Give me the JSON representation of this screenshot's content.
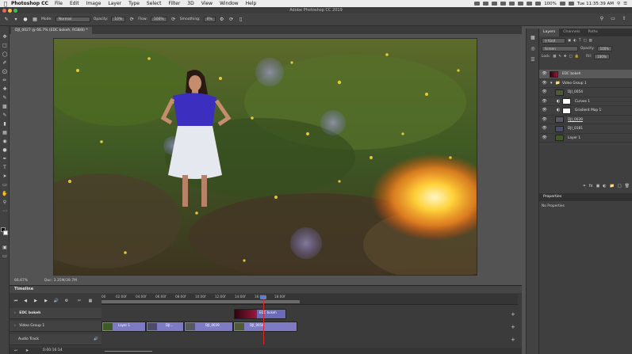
{
  "menubar": {
    "app": "Photoshop CC",
    "items": [
      "File",
      "Edit",
      "Image",
      "Layer",
      "Type",
      "Select",
      "Filter",
      "3D",
      "View",
      "Window",
      "Help"
    ],
    "battery": "100%",
    "clock": "Tue 11:35:39 AM"
  },
  "window": {
    "title": "Adobe Photoshop CC 2019"
  },
  "options": {
    "mode_label": "Mode:",
    "mode_value": "Normal",
    "opacity_label": "Opacity:",
    "opacity_value": "10%",
    "flow_label": "Flow:",
    "flow_value": "100%",
    "smoothing_label": "Smoothing:",
    "smoothing_value": "0%"
  },
  "document": {
    "tab": "DJI_0027 @ 66.7% (EDC bokeh, RGB/8) *"
  },
  "status": {
    "zoom": "66.67%",
    "doc": "Doc: 3.35M/39.7M"
  },
  "timeline": {
    "title": "Timeline",
    "ruler": [
      "00",
      "02:00f",
      "04:00f",
      "06:00f",
      "08:00f",
      "10:00f",
      "12:00f",
      "14:00f",
      "16:00f",
      "18:00f"
    ],
    "tracks": [
      {
        "label": "EDC bokeh"
      },
      {
        "label": "Video Group 1"
      },
      {
        "label": "Audio Track"
      }
    ],
    "clips": {
      "edc": "EDC bokeh",
      "layer1": "Layer 1",
      "dji1": "DJI...",
      "dji0039": "DJI_0039",
      "dji0054": "DJI_0054"
    },
    "time_display": "0:00:16:14"
  },
  "layers_panel": {
    "tabs": [
      "Layers",
      "Channels",
      "Paths"
    ],
    "filter": "Kind",
    "blend": "Screen",
    "opacity_label": "Opacity:",
    "opacity_value": "100%",
    "lock_label": "Lock:",
    "fill_label": "Fill:",
    "fill_value": "100%",
    "layers": [
      {
        "name": "EDC bokeh"
      },
      {
        "name": "Video Group 1"
      },
      {
        "name": "DJI_0054"
      },
      {
        "name": "Curves 1"
      },
      {
        "name": "Gradient Map 1"
      },
      {
        "name": "DJI_0039"
      },
      {
        "name": "DJI_0181"
      },
      {
        "name": "Layer 1"
      }
    ]
  },
  "properties_panel": {
    "title": "Properties",
    "empty_text": "No Properties"
  },
  "colors": {
    "panel_bg": "#3f3f3f",
    "selected_layer": "#5a5a5a",
    "playhead": "#d82a2a",
    "video_clip": "#7c7bc4",
    "bokeh_clip": "#6a6ab8"
  }
}
